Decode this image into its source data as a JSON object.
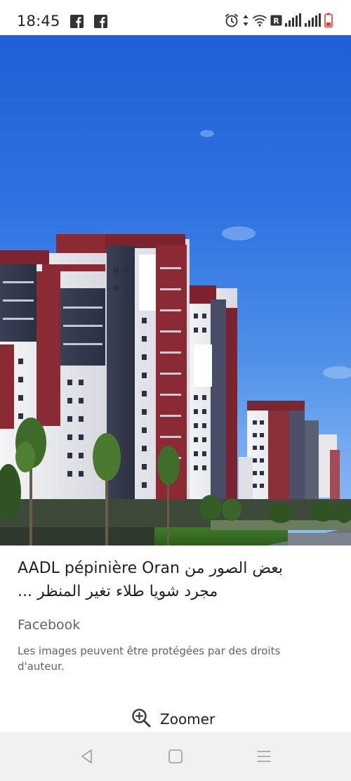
{
  "status_bar": {
    "time": "18:45",
    "notification_icons": [
      "facebook-icon",
      "facebook-icon"
    ],
    "system_icons": [
      "alarm-icon",
      "data-arrows-icon",
      "wifi-icon",
      "roaming-r-icon",
      "signal-icon",
      "signal-icon",
      "battery-low-icon"
    ],
    "battery_color": "#e53935"
  },
  "result": {
    "title_line_1": "AADL pépinière Oran بعض الصور من",
    "title_line_2": "مجرد شويا طلاء تغير المنظر ...",
    "source": "Facebook",
    "notice": "Les images peuvent être protégées par des droits d'auteur.",
    "zoom_label": "Zoomer",
    "zoom_icon": "zoom-in-icon"
  },
  "nav_bar": {
    "buttons": [
      "back-icon",
      "home-icon",
      "menu-icon"
    ]
  },
  "colors": {
    "sky": "#2f74e2",
    "text_primary": "#202124",
    "text_secondary": "#5f6368",
    "nav_background": "#f1f1f1"
  }
}
